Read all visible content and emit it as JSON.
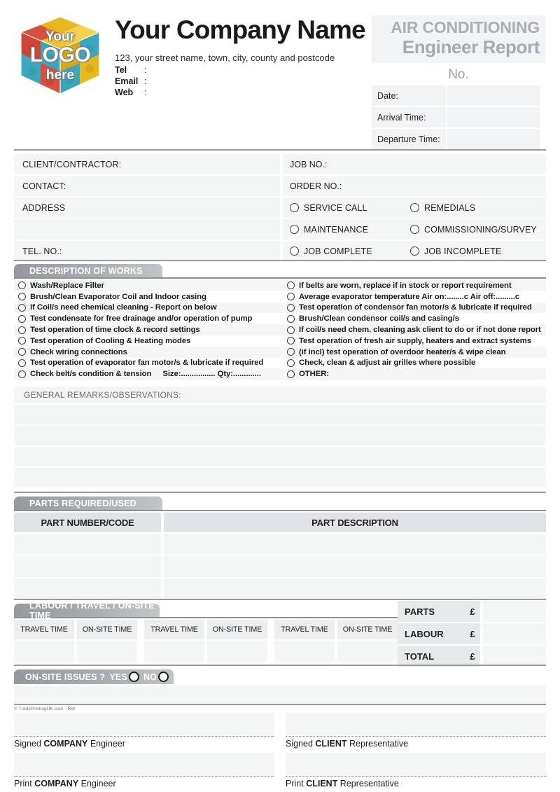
{
  "header": {
    "logo": {
      "line1": "Your",
      "line2": "LOGO",
      "line3": "here",
      "alt": "puzzle-cube-logo"
    },
    "company_name": "Your Company Name",
    "address": "123, your street name, town, city, county and postcode",
    "contacts": [
      {
        "key": "Tel",
        "colon": ":",
        "value": ""
      },
      {
        "key": "Email",
        "colon": ":",
        "value": ""
      },
      {
        "key": "Web",
        "colon": ":",
        "value": ""
      }
    ],
    "title_line1": "AIR CONDITIONING",
    "title_line2": "Engineer Report",
    "no_label": "No.",
    "fields": [
      {
        "label": "Date:",
        "value": ""
      },
      {
        "label": "Arrival Time:",
        "value": ""
      },
      {
        "label": "Departure Time:",
        "value": ""
      }
    ]
  },
  "client": {
    "rows": [
      {
        "left": "CLIENT/CONTRACTOR:",
        "right_label": "JOB NO.:"
      },
      {
        "left": "CONTACT:",
        "right_label": "ORDER NO.:"
      },
      {
        "left": "ADDRESS",
        "right_label": ""
      },
      {
        "left": "",
        "right_label": ""
      },
      {
        "left": "TEL. NO.:",
        "right_label": ""
      }
    ],
    "job_types": [
      {
        "a": "SERVICE CALL",
        "b": "REMEDIALS"
      },
      {
        "a": "MAINTENANCE",
        "b": "COMMISSIONING/SURVEY"
      },
      {
        "a": "JOB COMPLETE",
        "b": "JOB INCOMPLETE"
      }
    ]
  },
  "description_of_works": {
    "tab_label": "DESCRIPTION OF WORKS",
    "left_items": [
      "Wash/Replace Filter",
      "Brush/Clean Evaporator Coil and Indoor casing",
      "If Coil/s need chemical cleaning - Report on below",
      "Test condensate for free drainage and/or operation of pump",
      "Test operation of time clock & record settings",
      "Test operation of Cooling & Heating modes",
      "Check wiring connections",
      "Test operation of evaporator fan motor/s & lubricate if required",
      "Check belt/s condition & tension"
    ],
    "left_extra_9": "Size:................  Qty:.............",
    "right_items": [
      "If belts are worn, replace if in stock or report requirement",
      "Average evaporator temperature  Air on:........c  Air off:.........c",
      "Test operation of condensor fan motor/s & lubricate if required",
      "Brush/Clean condensor coil/s and casing/s",
      "If coil/s need chem. cleaning ask client to do or if not done report",
      "Test operation of fresh air supply, heaters and extract systems",
      "(if incl) test operation of overdoor heater/s & wipe clean",
      "Check, clean & adjust air grilles where possible",
      "OTHER:"
    ]
  },
  "remarks": {
    "label": "GENERAL REMARKS/OBSERVATIONS:",
    "blank_lines": 4
  },
  "parts": {
    "tab_label": "PARTS REQUIRED/USED",
    "columns": [
      "PART NUMBER/CODE",
      "PART DESCRIPTION"
    ],
    "rows": [
      {
        "code": "",
        "description": ""
      },
      {
        "code": "",
        "description": ""
      },
      {
        "code": "",
        "description": ""
      }
    ]
  },
  "labour": {
    "tab_label": "LABOUR / TRAVEL / ON-SITE TIME",
    "columns": [
      "TRAVEL TIME",
      "ON-SITE TIME",
      "TRAVEL TIME",
      "ON-SITE TIME",
      "TRAVEL TIME",
      "ON-SITE TIME"
    ],
    "values": [
      "",
      "",
      "",
      "",
      "",
      ""
    ]
  },
  "totals": {
    "currency": "£",
    "rows": [
      {
        "label": "PARTS",
        "value": ""
      },
      {
        "label": "LABOUR",
        "value": ""
      },
      {
        "label": "TOTAL",
        "value": ""
      }
    ]
  },
  "issues": {
    "label": "ON-SITE ISSUES ?",
    "yes": "YES",
    "no": "NO"
  },
  "footer": {
    "copyright": "© TradePrintingUK.com - Ref:",
    "signatures": [
      {
        "pre": "Signed ",
        "bold": "COMPANY",
        "post": " Engineer"
      },
      {
        "pre": "Signed ",
        "bold": "CLIENT",
        "post": " Representative"
      },
      {
        "pre": "Print ",
        "bold": "COMPANY",
        "post": " Engineer"
      },
      {
        "pre": "Print ",
        "bold": "CLIENT",
        "post": " Representative"
      }
    ]
  },
  "colors": {
    "tab_dark": "#95999d",
    "tab_light": "#c3c6c9",
    "field_bg": "#f4f5f5",
    "table_head_bg": "#e1e4e6",
    "title_gray": "#a9afb5",
    "rule": "#9a9a9a"
  }
}
